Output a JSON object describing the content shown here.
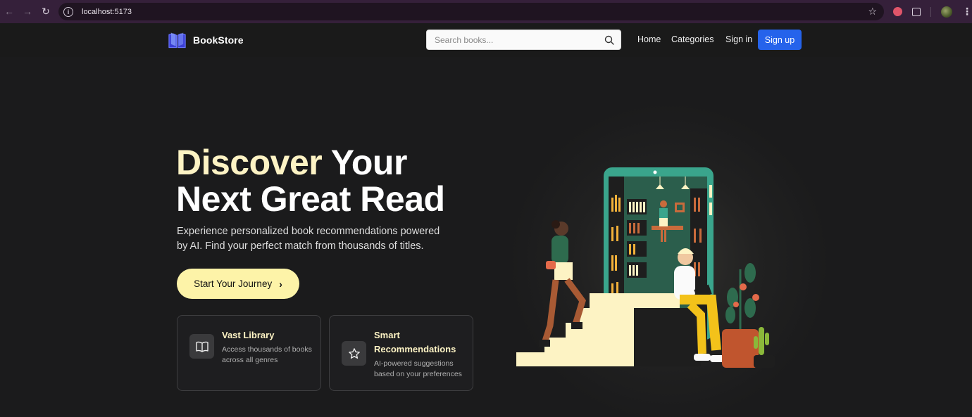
{
  "browser": {
    "url": "localhost:5173"
  },
  "navbar": {
    "brand": "BookStore",
    "search_placeholder": "Search books...",
    "links": [
      "Home",
      "Categories",
      "Sign in"
    ],
    "signup_label": "Sign up"
  },
  "hero": {
    "title_accent": "Discover",
    "title_rest_line1": "Your",
    "title_line2": "Next Great Read",
    "subtitle": "Experience personalized book recommendations powered by AI. Find your perfect match from thousands of titles.",
    "cta_label": "Start Your Journey"
  },
  "features": [
    {
      "title": "Vast Library",
      "description": "Access thousands of books across all genres",
      "icon": "book-open-icon"
    },
    {
      "title": "Smart Recommendations",
      "description": "AI-powered suggestions based on your preferences",
      "icon": "star-icon"
    }
  ],
  "colors": {
    "accent": "#fdf3c4",
    "cta_bg": "#fdf3a8",
    "primary_button": "#2563eb",
    "background": "#1b1b1c"
  }
}
